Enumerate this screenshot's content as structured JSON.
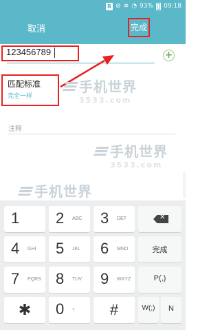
{
  "status_bar": {
    "battery_percent": "93%",
    "time": "09:18",
    "icons": [
      "b-icon",
      "signal-cutoff-icon",
      "wifi-icon",
      "alarm-icon",
      "battery-icon"
    ]
  },
  "action_bar": {
    "cancel_label": "取消",
    "done_label": "完成"
  },
  "form": {
    "number_value": "123456789",
    "add_icon": "+",
    "match_title": "匹配标准",
    "match_value": "完全一样",
    "note_placeholder": "注释"
  },
  "watermark": {
    "brand": "手机世界",
    "site": "3533.com"
  },
  "keyboard": {
    "rows": [
      [
        {
          "num": "1",
          "letters": ""
        },
        {
          "num": "2",
          "letters": "ABC"
        },
        {
          "num": "3",
          "letters": "DEF"
        }
      ],
      [
        {
          "num": "4",
          "letters": "GHI"
        },
        {
          "num": "5",
          "letters": "JKL"
        },
        {
          "num": "6",
          "letters": "MNO"
        }
      ],
      [
        {
          "num": "7",
          "letters": "PQRS"
        },
        {
          "num": "8",
          "letters": "TUV"
        },
        {
          "num": "9",
          "letters": "WXYZ"
        }
      ],
      [
        {
          "num": "✱",
          "letters": ""
        },
        {
          "num": "0",
          "letters": "+"
        },
        {
          "num": "#",
          "letters": ""
        }
      ]
    ],
    "backspace_label": "✕",
    "done_label": "完成",
    "pause_label": "P(,)",
    "wait_label": "W(;)",
    "next_label": "N"
  },
  "colors": {
    "accent": "#5bb8c9",
    "highlight_red": "#e8201f",
    "add_green": "#6bb04f"
  }
}
